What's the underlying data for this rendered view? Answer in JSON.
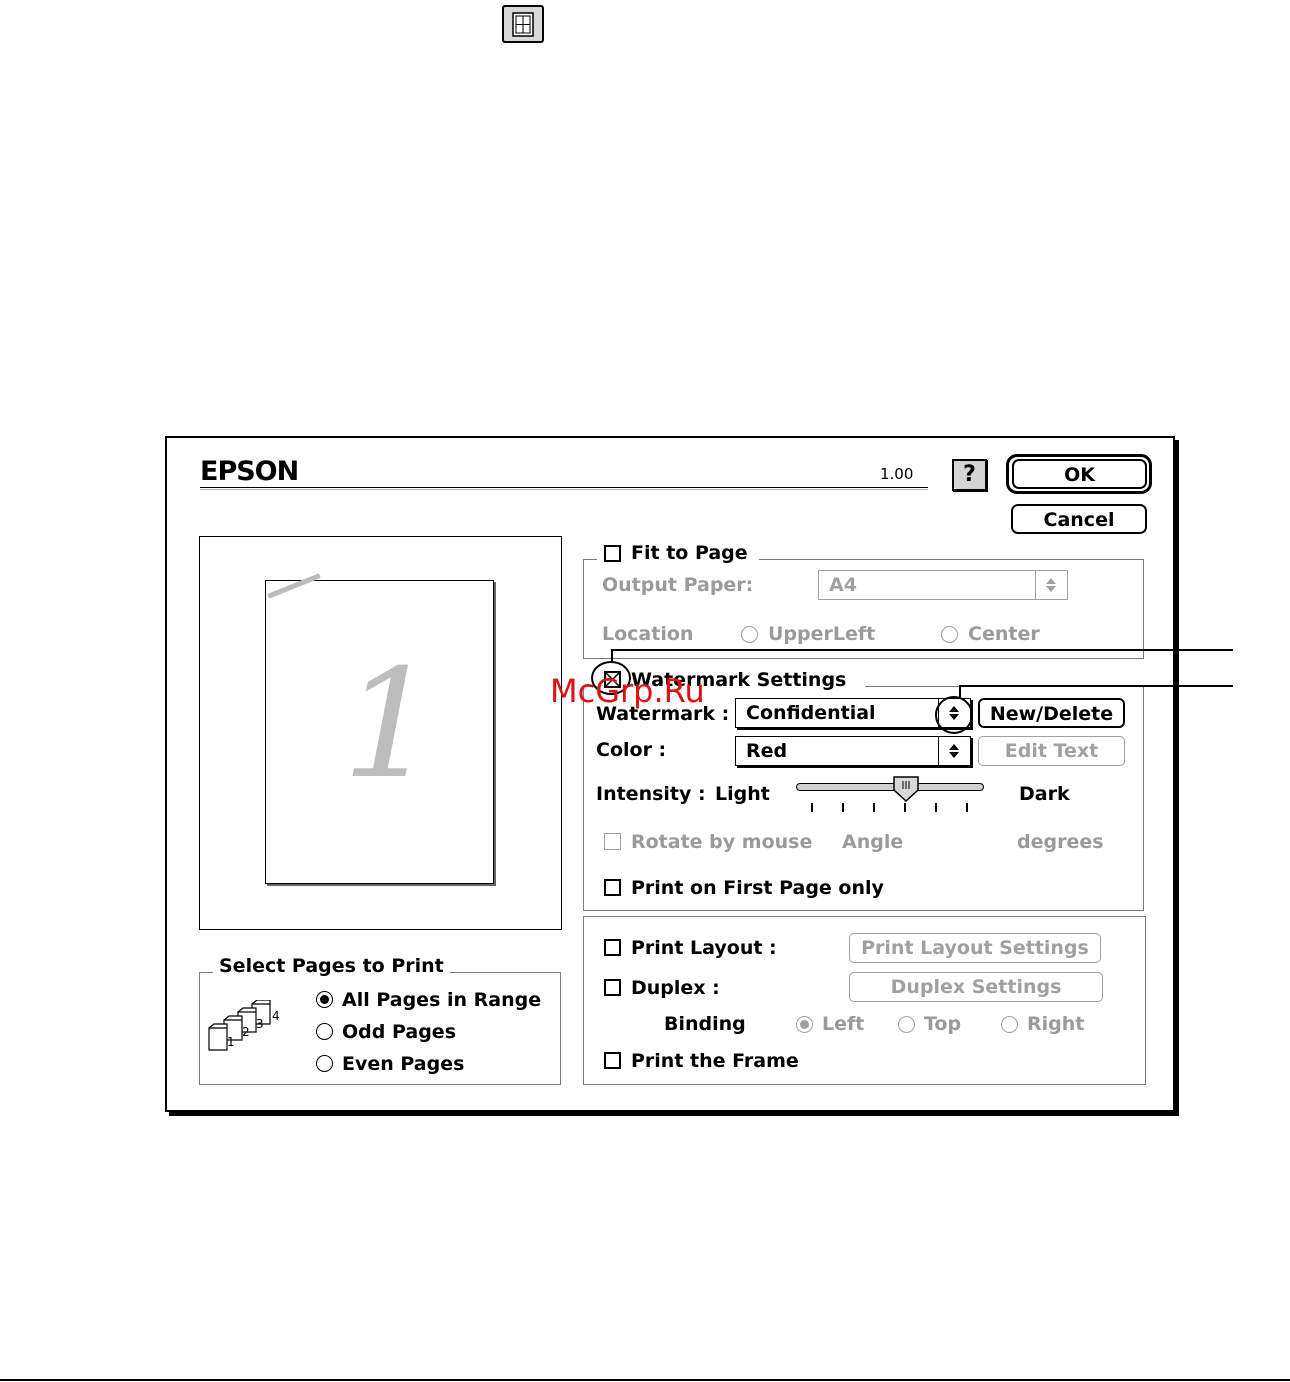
{
  "toolbar": {
    "icon": "print-layout-icon"
  },
  "dialog": {
    "brand": "EPSON",
    "version": "1.00",
    "help_label": "?",
    "ok_label": "OK",
    "cancel_label": "Cancel"
  },
  "preview": {
    "page_number": "1"
  },
  "select_pages": {
    "legend": "Select Pages to Print",
    "options": [
      {
        "label": "All Pages in Range",
        "selected": true
      },
      {
        "label": "Odd Pages",
        "selected": false
      },
      {
        "label": "Even Pages",
        "selected": false
      }
    ],
    "icon_pages": [
      "1",
      "2",
      "3",
      "4"
    ]
  },
  "fit_to_page": {
    "label": "Fit to Page",
    "checked": false,
    "output_paper_label": "Output Paper:",
    "output_paper_value": "A4",
    "location_label": "Location",
    "location_options": [
      "UpperLeft",
      "Center"
    ]
  },
  "watermark_settings": {
    "label": "Watermark Settings",
    "checked": true,
    "watermark_label": "Watermark :",
    "watermark_value": "Confidential",
    "new_delete_label": "New/Delete",
    "color_label": "Color :",
    "color_value": "Red",
    "edit_text_label": "Edit Text",
    "intensity_label": "Intensity :",
    "intensity_light": "Light",
    "intensity_dark": "Dark",
    "intensity_level": 0.58,
    "rotate_label": "Rotate by mouse",
    "angle_label": "Angle",
    "degrees_label": "degrees",
    "first_page_label": "Print on First Page only"
  },
  "layout_group": {
    "print_layout_label": "Print Layout :",
    "print_layout_settings_label": "Print Layout Settings",
    "duplex_label": "Duplex :",
    "duplex_settings_label": "Duplex Settings",
    "binding_label": "Binding",
    "binding_options": [
      "Left",
      "Top",
      "Right"
    ],
    "print_frame_label": "Print the Frame"
  },
  "overlay_watermark": "McGrp.Ru",
  "colors": {
    "overlay": "#e01010",
    "dimmed": "#9a9a9a"
  }
}
